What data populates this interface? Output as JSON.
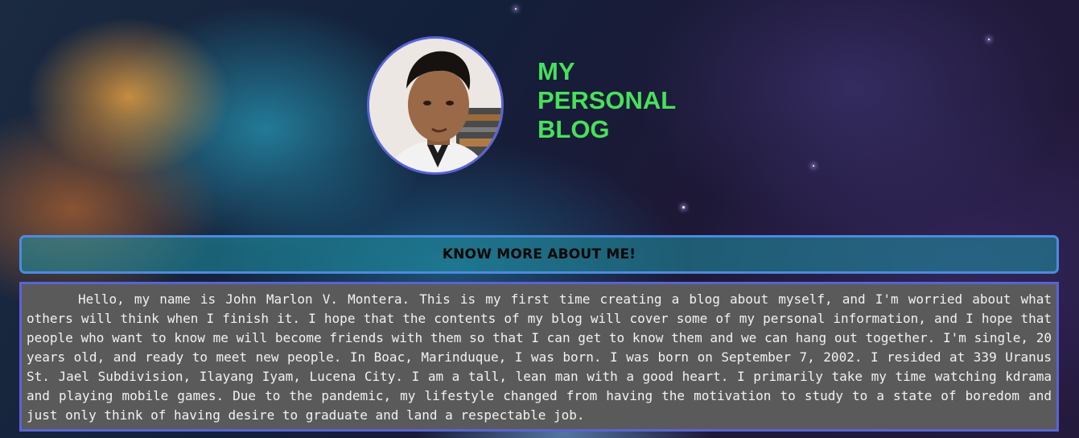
{
  "header": {
    "title": "MY PERSONAL BLOG",
    "avatar_icon": "profile-photo"
  },
  "section": {
    "heading": "KNOW MORE ABOUT ME!"
  },
  "about": {
    "text": "Hello, my name is John Marlon V. Montera. This is my first time creating a blog about myself, and I'm worried about what others will think when I finish it. I hope that the contents of my blog will cover some of my personal information, and I hope that people who want to know me will become friends with them so that I can get to know them and we can hang out together. I'm single, 20 years old, and ready to meet new people. In Boac, Marinduque, I was born. I was born on September 7, 2002. I resided at 339 Uranus St. Jael Subdivision, Ilayang Iyam, Lucena City. I am a tall, lean man with a good heart. I primarily take my time watching kdrama and playing mobile games. Due to the pandemic, my lifestyle changed from having the motivation to study to a state of boredom and just only think of having desire to graduate and land a respectable job."
  },
  "colors": {
    "title": "#47e15a",
    "avatar_border": "#5a63d6",
    "bar_border": "#4d8ae0",
    "bar_fill": "#2096a5",
    "about_bg": "#5a5a5a",
    "about_text": "#f2f2f2"
  }
}
